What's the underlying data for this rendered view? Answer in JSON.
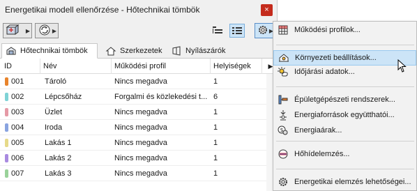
{
  "window": {
    "title": "Energetikai modell ellenőrzése - Hőtechnikai tömbök",
    "close_glyph": "×"
  },
  "tabs": [
    {
      "label": "Hőtechnikai tömbök",
      "icon": "zone-block-icon"
    },
    {
      "label": "Szerkezetek",
      "icon": "house-icon"
    },
    {
      "label": "Nyílászárók",
      "icon": "window-icon"
    }
  ],
  "table": {
    "columns": [
      "ID",
      "Név",
      "Működési profil",
      "Helyiségek"
    ],
    "rows": [
      {
        "id": "001",
        "name": "Tároló",
        "profile": "Nincs megadva",
        "rooms": "1",
        "color": "#e8842c"
      },
      {
        "id": "002",
        "name": "Lépcsőház",
        "profile": "Forgalmi és közlekedési t...",
        "rooms": "6",
        "color": "#7fd3d6"
      },
      {
        "id": "003",
        "name": "Üzlet",
        "profile": "Nincs megadva",
        "rooms": "1",
        "color": "#e59aa6"
      },
      {
        "id": "004",
        "name": "Iroda",
        "profile": "Nincs megadva",
        "rooms": "1",
        "color": "#8aa4e0"
      },
      {
        "id": "005",
        "name": "Lakás 1",
        "profile": "Nincs megadva",
        "rooms": "1",
        "color": "#e6da8a"
      },
      {
        "id": "006",
        "name": "Lakás 2",
        "profile": "Nincs megadva",
        "rooms": "1",
        "color": "#a98be0"
      },
      {
        "id": "007",
        "name": "Lakás 3",
        "profile": "Nincs megadva",
        "rooms": "1",
        "color": "#9ad29a"
      }
    ]
  },
  "menu": {
    "items": [
      {
        "label": "Működési profilok...",
        "icon": "grid-icon"
      },
      {
        "label": "Környezeti beállítások...",
        "icon": "environment-icon",
        "highlighted": true
      },
      {
        "label": "Időjárási adatok...",
        "icon": "sun-icon"
      },
      {
        "label": "Épületgépészeti rendszerek...",
        "icon": "mep-systems-icon"
      },
      {
        "label": "Energiaforrások együtthatói...",
        "icon": "energy-source-icon"
      },
      {
        "label": "Energiaárak...",
        "icon": "price-icon"
      },
      {
        "label": "Hőhídelemzés...",
        "icon": "thermal-bridge-icon"
      },
      {
        "label": "Energetikai elemzés lehetőségei...",
        "icon": "gear-icon"
      }
    ]
  },
  "colors": {
    "highlight": "#cce4f7",
    "close": "#c42b1c"
  }
}
